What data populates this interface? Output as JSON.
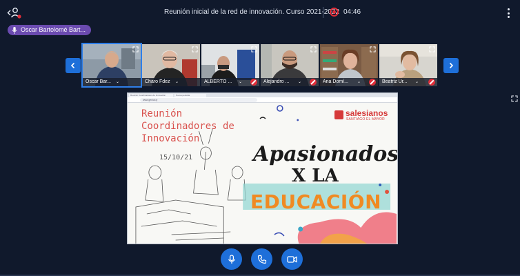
{
  "header": {
    "title": "Reunión inicial de la red de innovación. Curso 2021-2022",
    "timer": "04:46"
  },
  "active_speaker": {
    "name": "Oscar Bartolomé Bart..."
  },
  "participants": [
    {
      "name": "Oscar Bar...",
      "muted": false,
      "active": true
    },
    {
      "name": "Charo Fdez",
      "muted": false,
      "active": false
    },
    {
      "name": "ALBERTO ...",
      "muted": true,
      "active": false
    },
    {
      "name": "Alejandro ...",
      "muted": true,
      "active": false
    },
    {
      "name": "Ana Domí...",
      "muted": true,
      "active": false
    },
    {
      "name": "Beatriz Ur...",
      "muted": true,
      "active": false
    }
  ],
  "shared_screen": {
    "browser": {
      "tab_1": "Reunión Coordinadores de Innovación",
      "tab_2": "Nueva pestaña",
      "address": "www.genial.ly"
    },
    "slide": {
      "heading": "Reunión\nCoordinadores de\nInnovación",
      "date": "15/10/21",
      "brand_name": "salesianos",
      "brand_sub": "SANTIAGO EL MAYOR",
      "tagline_1": "Apasionados",
      "tagline_2": "X LA",
      "tagline_3": "EDUCACIÓN"
    }
  },
  "controls": {
    "mic": "microphone",
    "call": "phone",
    "camera": "camera"
  },
  "colors": {
    "background": "#10192c",
    "accent": "#1e6fd9",
    "record": "#e02d39",
    "speaker_pill": "#6b4bb0"
  }
}
